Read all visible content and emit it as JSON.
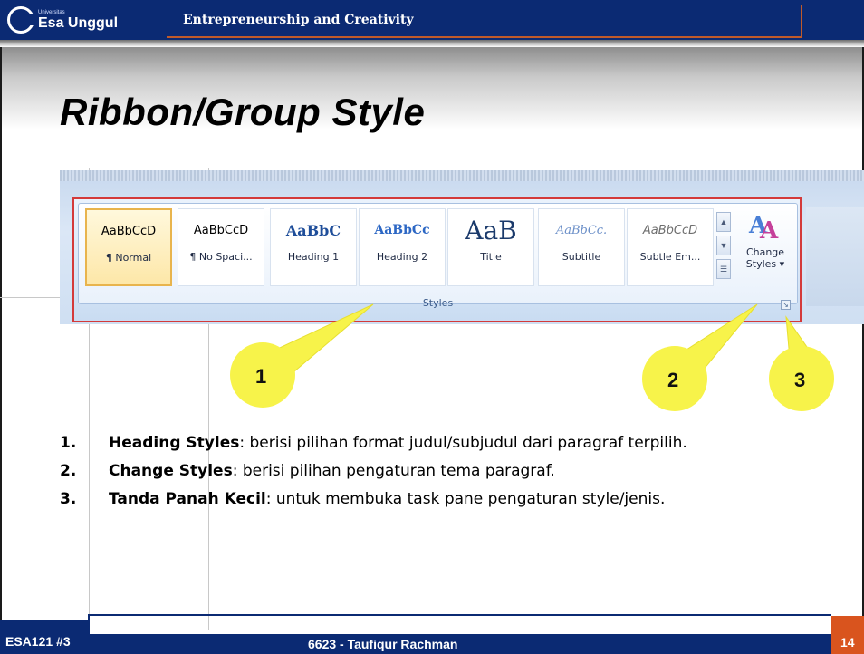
{
  "header": {
    "logo_small": "Universitas",
    "logo_name": "Esa Unggul",
    "course_title": "Entrepreneurship and Creativity"
  },
  "slide": {
    "title": "Ribbon/Group Style"
  },
  "ribbon": {
    "styles": [
      {
        "preview": "AaBbCcD",
        "label": "¶ Normal",
        "selected": true
      },
      {
        "preview": "AaBbCcD",
        "label": "¶ No Spaci...",
        "selected": false
      },
      {
        "preview": "AaBbC",
        "label": "Heading 1",
        "selected": false
      },
      {
        "preview": "AaBbCc",
        "label": "Heading 2",
        "selected": false
      },
      {
        "preview": "AaB",
        "label": "Title",
        "selected": false
      },
      {
        "preview": "AaBbCc.",
        "label": "Subtitle",
        "selected": false
      },
      {
        "preview": "AaBbCcD",
        "label": "Subtle Em...",
        "selected": false
      }
    ],
    "change_styles_line1": "Change",
    "change_styles_line2": "Styles ▾",
    "group_label": "Styles",
    "colors": {
      "border": "#d43a3a",
      "selected_fill": "#fde7a8",
      "heading_blue": "#1f4e9a"
    }
  },
  "callouts": [
    {
      "number": "1"
    },
    {
      "number": "2"
    },
    {
      "number": "3"
    }
  ],
  "list": [
    {
      "num": "1.",
      "term": "Heading Styles",
      "text": ": berisi pilihan format judul/subjudul dari paragraf terpilih."
    },
    {
      "num": "2.",
      "term": "Change Styles",
      "text": ": berisi pilihan pengaturan tema paragraf."
    },
    {
      "num": "3.",
      "term": "Tanda Panah Kecil",
      "text": ": untuk membuka task pane pengaturan style/jenis."
    }
  ],
  "footer": {
    "code": "ESA121 #3",
    "author": "6623 - Taufiqur Rachman",
    "page": "14"
  },
  "theme": {
    "navy": "#0b2a73",
    "orange": "#d9541e",
    "callout_yellow": "#f7f34a"
  }
}
